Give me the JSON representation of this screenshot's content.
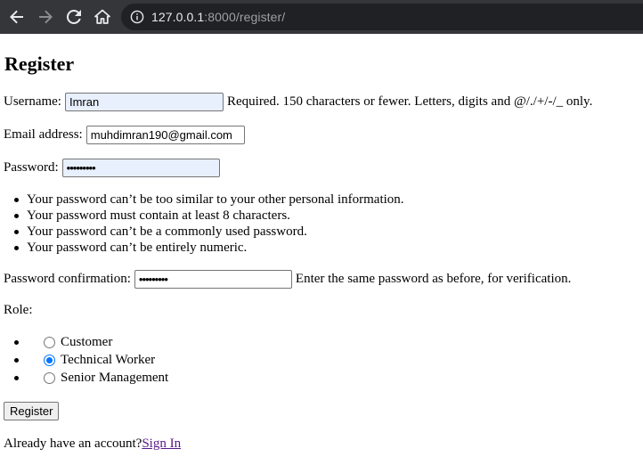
{
  "browser": {
    "url_host": "127.0.0.1",
    "url_rest": ":8000/register/"
  },
  "page": {
    "title": "Register",
    "username": {
      "label": "Username:",
      "value": "Imran",
      "help": "Required. 150 characters or fewer. Letters, digits and @/./+/-/_ only."
    },
    "email": {
      "label": "Email address:",
      "value": "muhdimran190@gmail.com"
    },
    "password": {
      "label": "Password:",
      "value": "•••••••••",
      "rules": [
        "Your password can’t be too similar to your other personal information.",
        "Your password must contain at least 8 characters.",
        "Your password can’t be a commonly used password.",
        "Your password can’t be entirely numeric."
      ]
    },
    "password2": {
      "label": "Password confirmation:",
      "value": "•••••••••",
      "help": "Enter the same password as before, for verification."
    },
    "role": {
      "label": "Role:",
      "options": [
        "Customer",
        "Technical Worker",
        "Senior Management"
      ],
      "selected": "Technical Worker"
    },
    "submit_label": "Register",
    "already_text": "Already have an account?",
    "signin_label": "Sign In"
  },
  "icons": {
    "back": "back-arrow-icon",
    "forward": "forward-arrow-icon",
    "reload": "reload-icon",
    "home": "home-icon",
    "info": "info-icon"
  },
  "colors": {
    "chrome_bg": "#35363a",
    "omnibox_bg": "#202124",
    "link_visited": "#551a8b",
    "radio_accent": "#0075ff",
    "autofill_bg": "#e8f0fe"
  }
}
